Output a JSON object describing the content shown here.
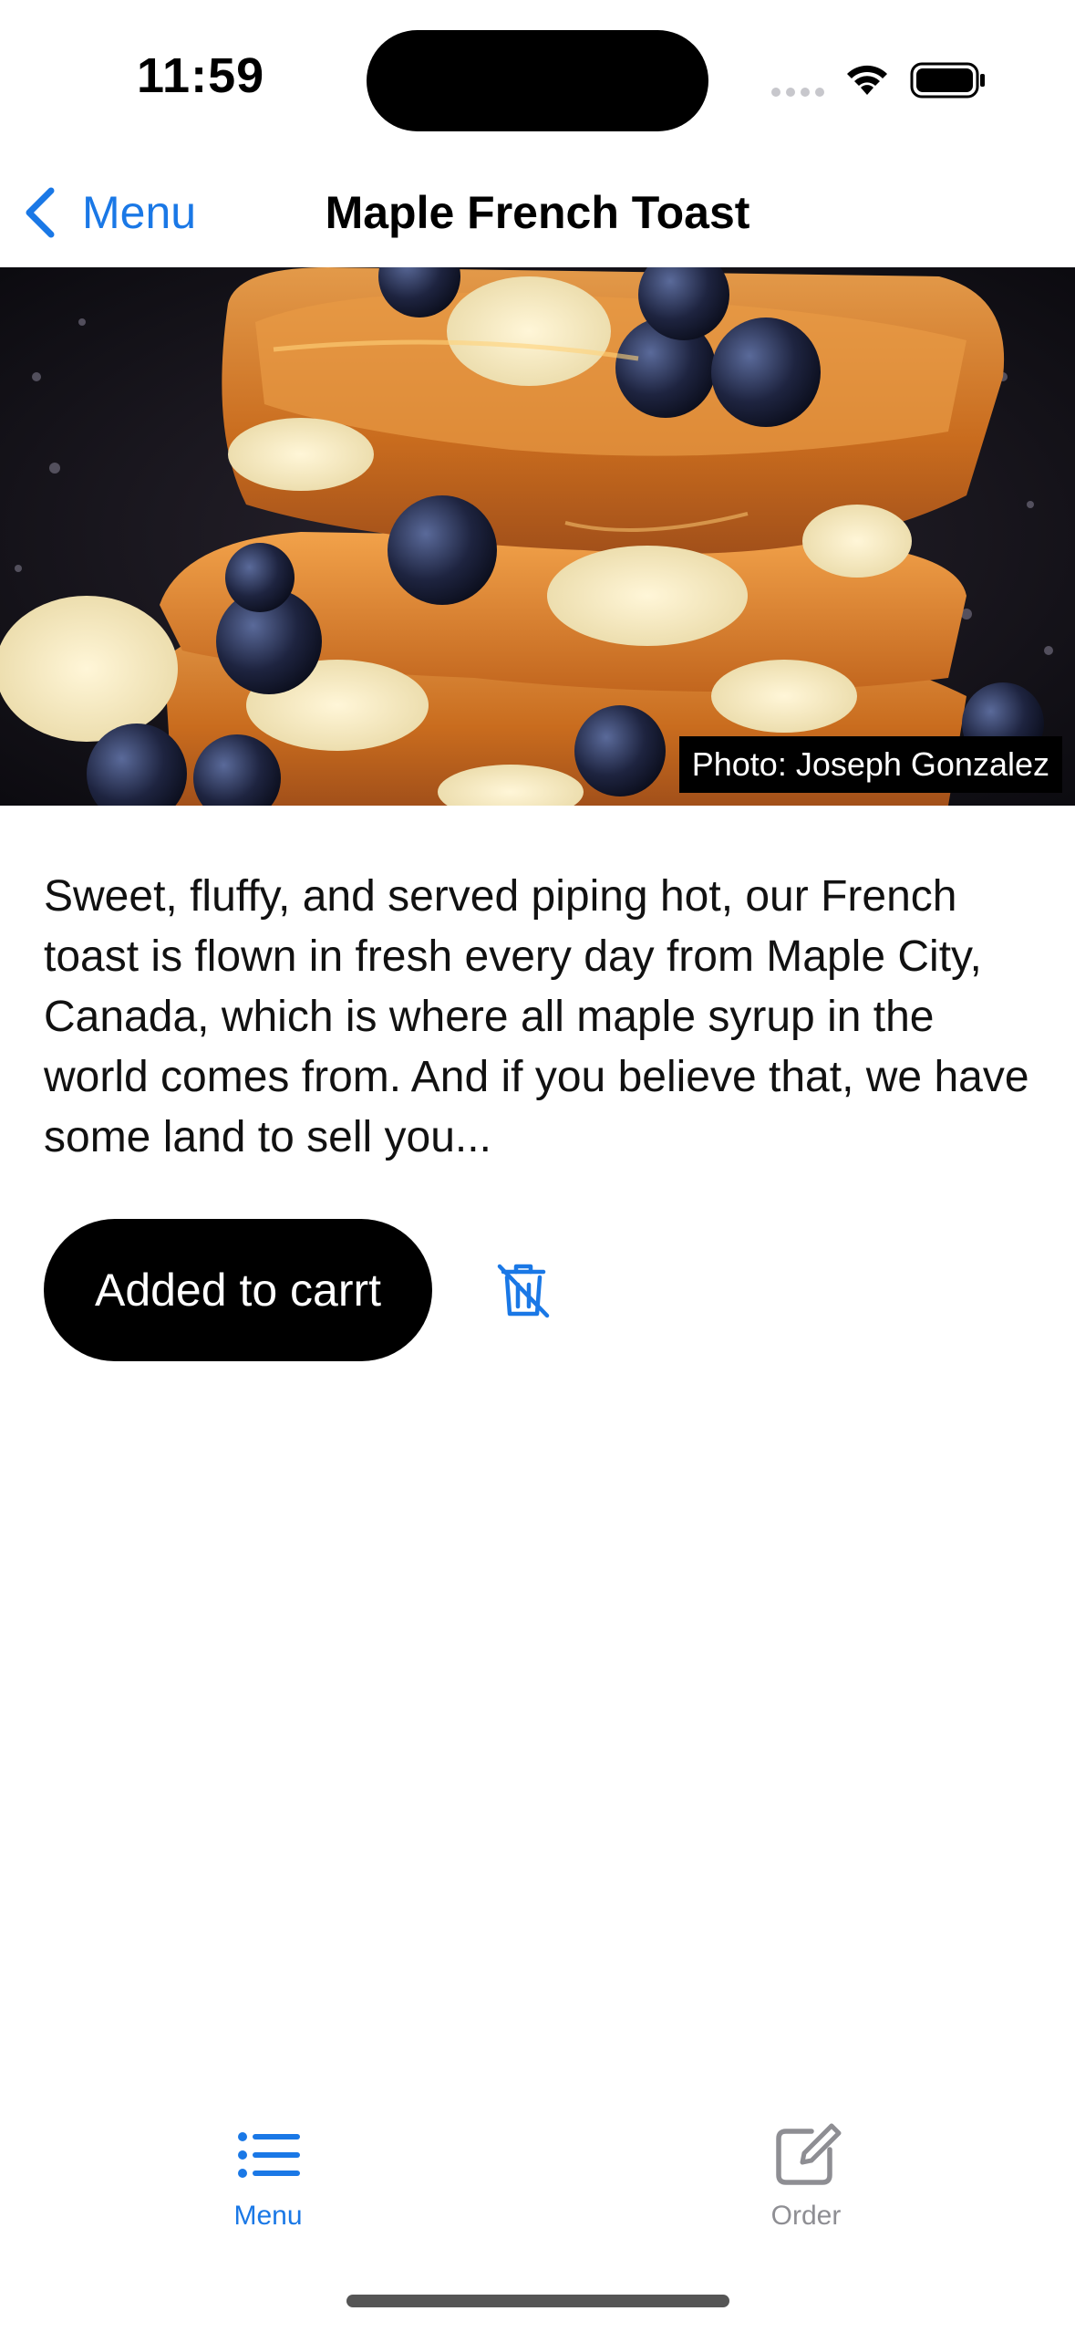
{
  "status_bar": {
    "time": "11:59"
  },
  "nav": {
    "back_label": "Menu",
    "title": "Maple French Toast"
  },
  "hero": {
    "photo_credit": "Photo: Joseph Gonzalez"
  },
  "item": {
    "description": "Sweet, fluffy, and served piping hot, our French toast is flown in fresh every day from Maple City, Canada, which is where all maple syrup in the world comes from. And if you believe that, we have some land to sell you...",
    "add_button_label": "Added to carrt"
  },
  "tabs": [
    {
      "label": "Menu",
      "icon": "list-icon",
      "active": true
    },
    {
      "label": "Order",
      "icon": "square-pencil-icon",
      "active": false
    }
  ],
  "colors": {
    "accent": "#1a78e6",
    "inactive_tab": "#8e8e93",
    "button_bg": "#000000",
    "button_text": "#ffffff"
  }
}
